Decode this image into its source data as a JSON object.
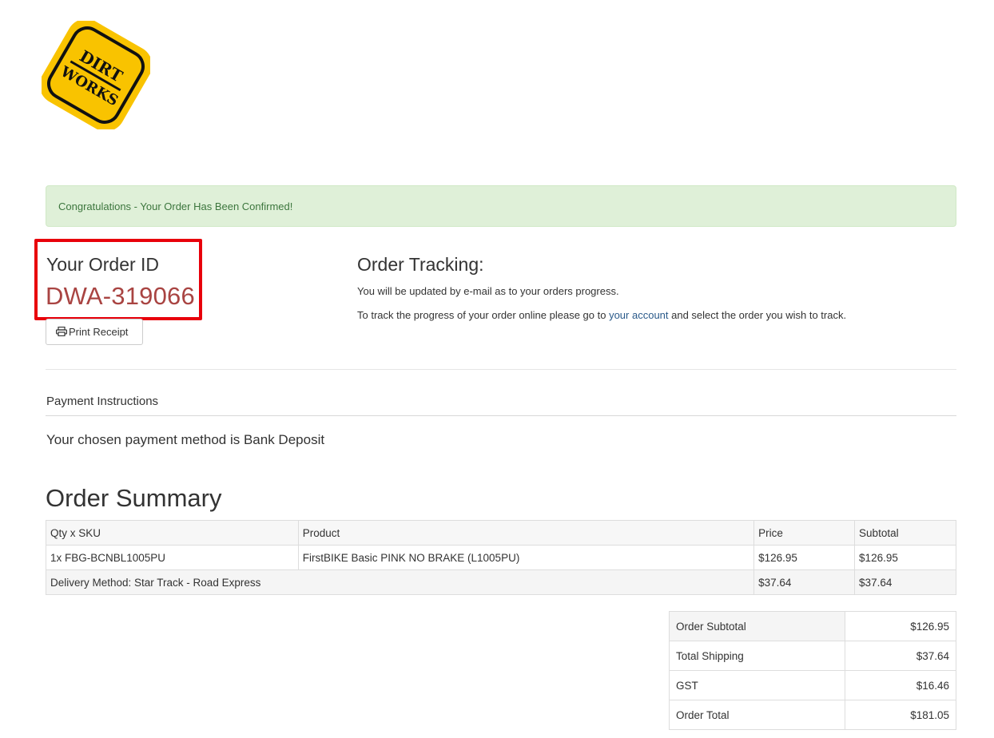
{
  "logo": {
    "line1": "DIRT",
    "line2": "WORKS",
    "bg_color": "#f9c300",
    "ink_color": "#111111"
  },
  "alert": {
    "text": "Congratulations - Your Order Has Been Confirmed!"
  },
  "order": {
    "label": "Your Order ID",
    "id": "DWA-319066",
    "print_label": "Print Receipt"
  },
  "tracking": {
    "title": "Order Tracking:",
    "line1": "You will be updated by e-mail as to your orders progress.",
    "line2_before": "To track the progress of your order online please go to ",
    "line2_link": "your account",
    "line2_after": " and select the order you wish to track."
  },
  "payment": {
    "title": "Payment Instructions",
    "method_text": "Your chosen payment method is Bank Deposit"
  },
  "summary": {
    "title": "Order Summary",
    "headers": [
      "Qty x SKU",
      "Product",
      "Price",
      "Subtotal"
    ],
    "rows": [
      {
        "qty_sku": "1x FBG-BCNBL1005PU",
        "product": "FirstBIKE Basic PINK NO BRAKE (L1005PU)",
        "price": "$126.95",
        "subtotal": "$126.95"
      }
    ],
    "delivery": {
      "label": "Delivery Method: Star Track - Road Express",
      "price": "$37.64",
      "subtotal": "$37.64"
    }
  },
  "totals": [
    {
      "label": "Order Subtotal",
      "value": "$126.95"
    },
    {
      "label": "Total Shipping",
      "value": "$37.64"
    },
    {
      "label": "GST",
      "value": "$16.46"
    },
    {
      "label": "Order Total",
      "value": "$181.05"
    }
  ]
}
